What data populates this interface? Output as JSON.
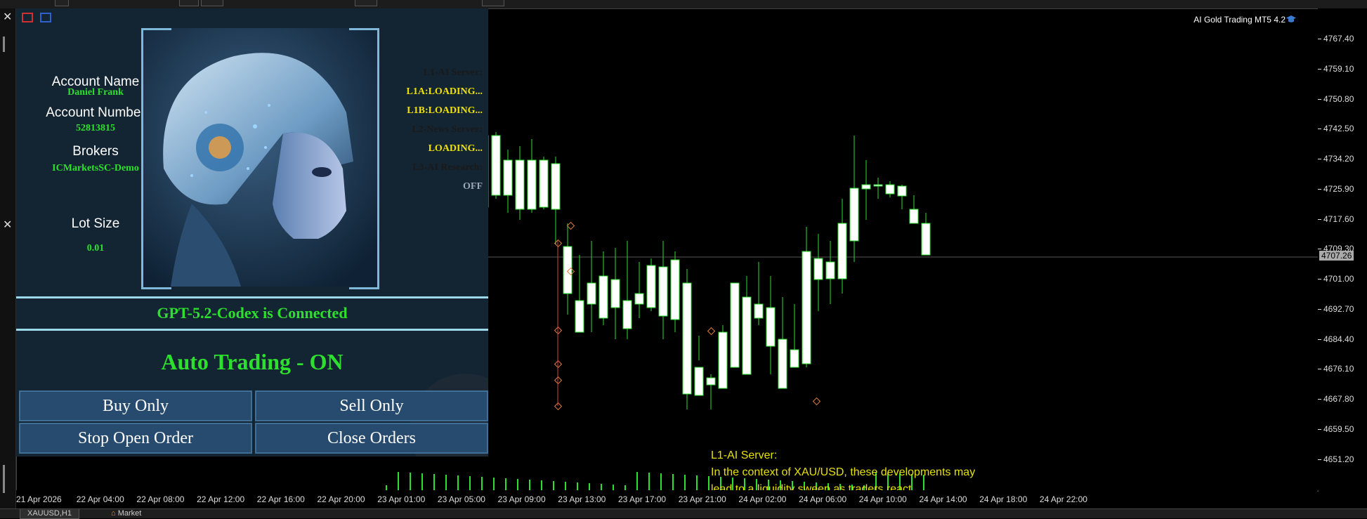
{
  "chart": {
    "title": "AI Gold Trading MT5 4.2",
    "current_price": "4707.26",
    "price_ticks": [
      "4767.40",
      "4759.10",
      "4750.80",
      "4742.50",
      "4734.20",
      "4725.90",
      "4717.60",
      "4709.30",
      "4701.00",
      "4692.70",
      "4684.40",
      "4676.10",
      "4667.80",
      "4659.50",
      "4651.20"
    ],
    "time_ticks": [
      "21 Apr 2026",
      "22 Apr 04:00",
      "22 Apr 08:00",
      "22 Apr 12:00",
      "22 Apr 16:00",
      "22 Apr 20:00",
      "23 Apr 01:00",
      "23 Apr 05:00",
      "23 Apr 09:00",
      "23 Apr 13:00",
      "23 Apr 17:00",
      "23 Apr 21:00",
      "24 Apr 02:00",
      "24 Apr 06:00",
      "24 Apr 10:00",
      "24 Apr 14:00",
      "24 Apr 18:00",
      "24 Apr 22:00"
    ],
    "colors": {
      "up_wick": "#2ee02e",
      "candle_body": "#ffffff",
      "volume": "#2ee02e",
      "grid_line": "#555555"
    }
  },
  "panel": {
    "account_name_label": "Account Name",
    "account_name": "Daniel Frank",
    "account_number_label": "Account Number",
    "account_number": "52813815",
    "brokers_label": "Brokers",
    "broker": "ICMarketsSC-Demo",
    "lot_size_label": "Lot Size",
    "lot_size": "0.01",
    "ai_status": [
      {
        "text": "L1-AI Server:",
        "color": "#1a1a1a"
      },
      {
        "text": "L1A:LOADING...",
        "color": "#f0e000"
      },
      {
        "text": "L1B:LOADING...",
        "color": "#f0e000"
      },
      {
        "text": "L2-News Server:",
        "color": "#1a1a1a"
      },
      {
        "text": "LOADING...",
        "color": "#f0e000"
      },
      {
        "text": "L3-AI Research:",
        "color": "#1a1a1a"
      },
      {
        "text": "OFF",
        "color": "#9aa8b8"
      }
    ],
    "connected": "GPT-5.2-Codex is Connected",
    "auto_trading": "Auto Trading - ON",
    "buttons": {
      "buy_only": "Buy Only",
      "sell_only": "Sell Only",
      "stop_open_order": "Stop Open Order",
      "close_orders": "Close Orders"
    }
  },
  "commentary": {
    "line1": "L1-AI Server:",
    "line2": "In the context of XAU/USD, these developments may",
    "line3": "lead to a liquidity sweep as traders react"
  },
  "tabs": [
    "XAUUSD,H1",
    "Market"
  ]
}
